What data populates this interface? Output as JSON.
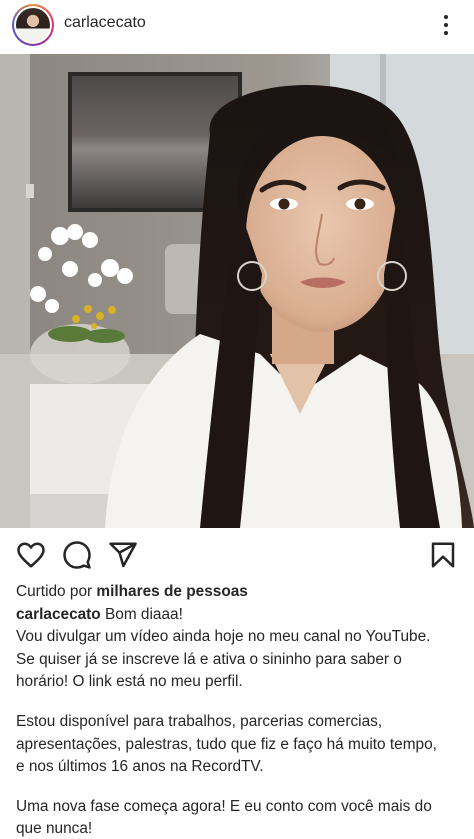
{
  "post": {
    "username": "carlacecato",
    "likes": {
      "prefix": "Curtido por",
      "count_text": "milhares de pessoas"
    },
    "caption": {
      "username": "carlacecato",
      "first_line": "Bom diaaa!",
      "lines": [
        "Vou divulgar um vídeo ainda hoje no meu canal no YouTube.",
        "Se quiser já se inscreve lá e ativa o sininho para saber o",
        "horário! O link está no meu perfil.",
        "",
        "Estou disponível para trabalhos, parcerias comercias,",
        "apresentações, palestras, tudo que fiz e faço há muito tempo,",
        "e nos últimos 16 anos na RecordTV.",
        "",
        "Uma nova fase começa agora! E eu conto com você mais do",
        "que nunca!"
      ]
    }
  },
  "icons": {
    "avatar": "profile-avatar",
    "more": "more-options-icon",
    "like": "heart-icon",
    "comment": "comment-icon",
    "share": "send-icon",
    "save": "bookmark-icon"
  }
}
